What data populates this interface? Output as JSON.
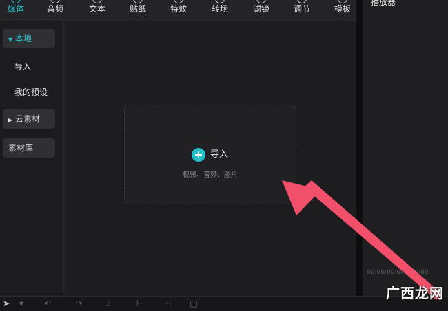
{
  "tabs": [
    {
      "label": "媒体",
      "icon": "media-icon",
      "active": true
    },
    {
      "label": "音频",
      "icon": "audio-icon"
    },
    {
      "label": "文本",
      "icon": "text-icon"
    },
    {
      "label": "贴纸",
      "icon": "sticker-icon"
    },
    {
      "label": "特效",
      "icon": "effects-icon"
    },
    {
      "label": "转场",
      "icon": "transition-icon"
    },
    {
      "label": "滤镜",
      "icon": "filter-icon"
    },
    {
      "label": "调节",
      "icon": "adjust-icon"
    },
    {
      "label": "模板",
      "icon": "template-icon"
    }
  ],
  "sidebar": {
    "local": "本地",
    "import": "导入",
    "presets": "我的预设",
    "cloud": "云素材",
    "library": "素材库"
  },
  "dropzone": {
    "label": "导入",
    "hint": "视频、音频、图片"
  },
  "player": {
    "title": "播放器",
    "timecode": "00:00:00:00 / 00:00"
  },
  "watermark": "广西龙网",
  "colors": {
    "accent": "#25c2cc",
    "arrow": "#f24f6b"
  }
}
